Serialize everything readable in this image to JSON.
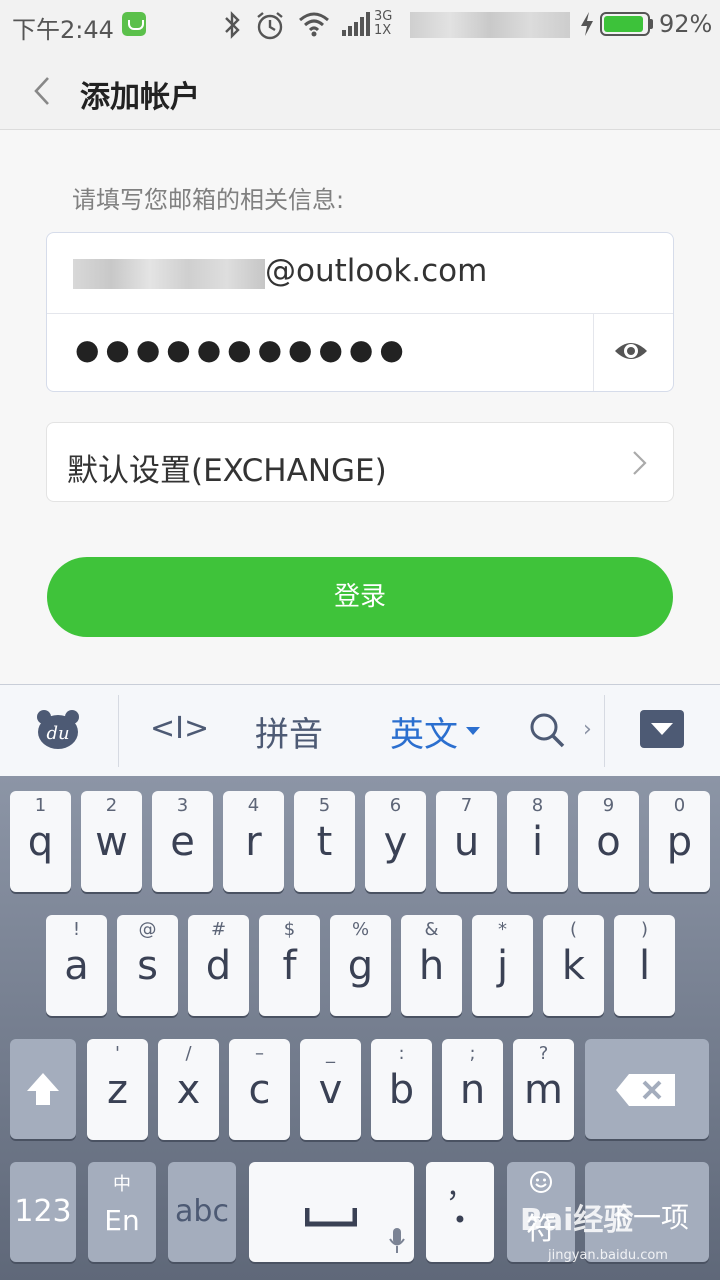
{
  "status_bar": {
    "time": "下午2:44",
    "network": "3G\n1X",
    "battery_percent": "92%",
    "battery_level": 0.92
  },
  "header": {
    "title": "添加帐户"
  },
  "form": {
    "prompt": "请填写您邮箱的相关信息:",
    "email_suffix": "@outlook.com",
    "password_masked": "●●●●●●●●●●●",
    "settings_label": "默认设置(EXCHANGE)",
    "login_label": "登录"
  },
  "keyboard": {
    "toolbar": {
      "cursor_label": "<I>",
      "pinyin_label": "拼音",
      "english_label": "英文"
    },
    "row1": [
      {
        "hint": "1",
        "key": "q"
      },
      {
        "hint": "2",
        "key": "w"
      },
      {
        "hint": "3",
        "key": "e"
      },
      {
        "hint": "4",
        "key": "r"
      },
      {
        "hint": "5",
        "key": "t"
      },
      {
        "hint": "6",
        "key": "y"
      },
      {
        "hint": "7",
        "key": "u"
      },
      {
        "hint": "8",
        "key": "i"
      },
      {
        "hint": "9",
        "key": "o"
      },
      {
        "hint": "0",
        "key": "p"
      }
    ],
    "row2": [
      {
        "hint": "!",
        "key": "a"
      },
      {
        "hint": "@",
        "key": "s"
      },
      {
        "hint": "#",
        "key": "d"
      },
      {
        "hint": "$",
        "key": "f"
      },
      {
        "hint": "%",
        "key": "g"
      },
      {
        "hint": "&",
        "key": "h"
      },
      {
        "hint": "*",
        "key": "j"
      },
      {
        "hint": "(",
        "key": "k"
      },
      {
        "hint": ")",
        "key": "l"
      }
    ],
    "row3": [
      {
        "hint": "'",
        "key": "z"
      },
      {
        "hint": "/",
        "key": "x"
      },
      {
        "hint": "–",
        "key": "c"
      },
      {
        "hint": "_",
        "key": "v"
      },
      {
        "hint": ":",
        "key": "b"
      },
      {
        "hint": ";",
        "key": "n"
      },
      {
        "hint": "?",
        "key": "m"
      }
    ],
    "bottom": {
      "num_label": "123",
      "lang_hint": "中",
      "lang_label": "En",
      "abc_label": "abc",
      "comma_label": "，",
      "period_label": "•",
      "symbol_label": "符",
      "next_label": "下一项"
    }
  },
  "watermark": {
    "text": "Bai经验",
    "url": "jingyan.baidu.com"
  }
}
